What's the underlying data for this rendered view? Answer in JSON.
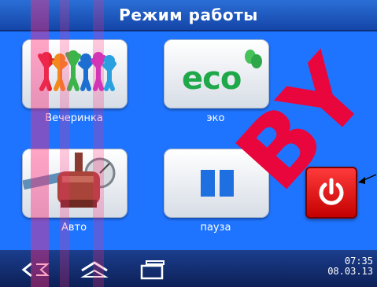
{
  "header": {
    "title": "Режим работы"
  },
  "tiles": [
    {
      "label": "Вечеринка",
      "icon": "party-people-icon"
    },
    {
      "label": "эко",
      "icon": "eco-icon",
      "text": "eco"
    },
    {
      "label": "Авто",
      "icon": "pool-pump-icon"
    },
    {
      "label": "пауза",
      "icon": "pause-icon"
    }
  ],
  "power_button": {
    "icon": "power-icon",
    "color": "#e00000"
  },
  "navbar": {
    "back_icon": "back-icon",
    "home_icon": "home-icon",
    "recent_icon": "recent-apps-icon",
    "time": "07:35",
    "date": "08.03.13"
  },
  "watermark": {
    "text": "BY",
    "color": "#e8063c"
  },
  "colors": {
    "background": "#1f74ff",
    "titlebar": "#1545a8",
    "navbar": "#0d2057",
    "accent": "#1e6fe0"
  }
}
